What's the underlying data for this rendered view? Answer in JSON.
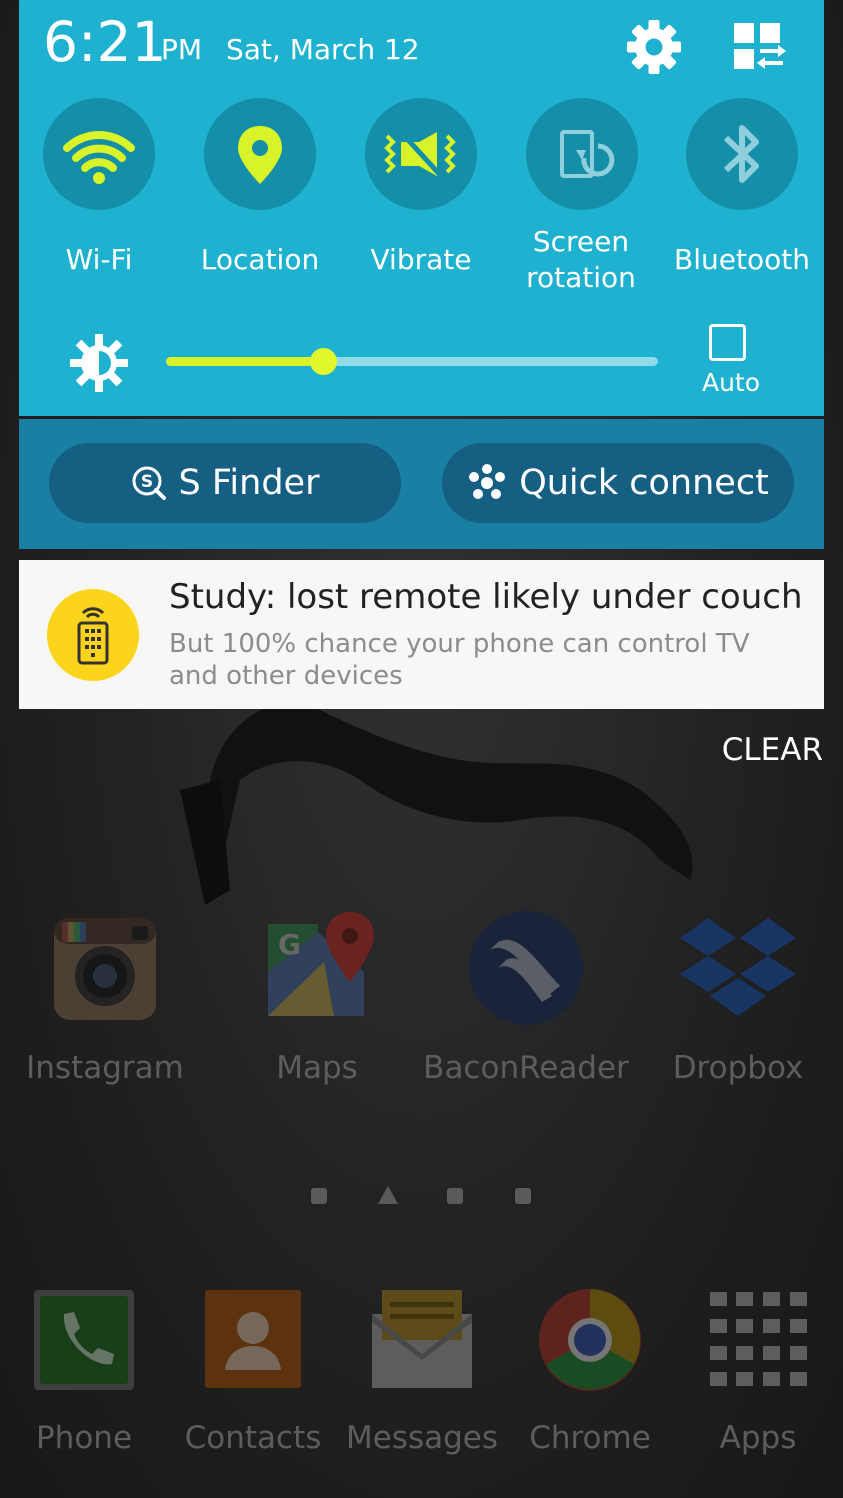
{
  "status": {
    "time": "6:21",
    "ampm": "PM",
    "date": "Sat, March 12"
  },
  "toggles": [
    {
      "label": "Wi-Fi",
      "icon": "wifi-icon",
      "active": true
    },
    {
      "label": "Location",
      "icon": "location-pin-icon",
      "active": true
    },
    {
      "label": "Vibrate",
      "icon": "vibrate-icon",
      "active": true
    },
    {
      "label": "Screen rotation",
      "icon": "screen-rotation-icon",
      "active": false
    },
    {
      "label": "Bluetooth",
      "icon": "bluetooth-icon",
      "active": false
    }
  ],
  "brightness": {
    "level": 0.32,
    "auto_label": "Auto",
    "auto_checked": false
  },
  "buttons": {
    "s_finder": "S Finder",
    "quick_connect": "Quick connect"
  },
  "notification": {
    "title": "Study: lost remote likely under couch",
    "body": "But 100% chance your phone can control TV and other devices",
    "icon": "remote-control-icon"
  },
  "clear_label": "CLEAR",
  "home_apps": [
    {
      "label": "Instagram",
      "icon": "instagram-icon"
    },
    {
      "label": "Maps",
      "icon": "maps-icon"
    },
    {
      "label": "BaconReader",
      "icon": "baconreader-icon"
    },
    {
      "label": "Dropbox",
      "icon": "dropbox-icon"
    }
  ],
  "dock_apps": [
    {
      "label": "Phone",
      "icon": "phone-icon"
    },
    {
      "label": "Contacts",
      "icon": "contacts-icon"
    },
    {
      "label": "Messages",
      "icon": "messages-icon"
    },
    {
      "label": "Chrome",
      "icon": "chrome-icon"
    },
    {
      "label": "Apps",
      "icon": "apps-grid-icon"
    }
  ],
  "colors": {
    "panel": "#1fb2d0",
    "toggle_bg": "#158ea7",
    "active_icon": "#d8f32a",
    "inactive_icon": "#8fcfdd",
    "subpanel": "#197fa3",
    "pill": "#155f82"
  }
}
